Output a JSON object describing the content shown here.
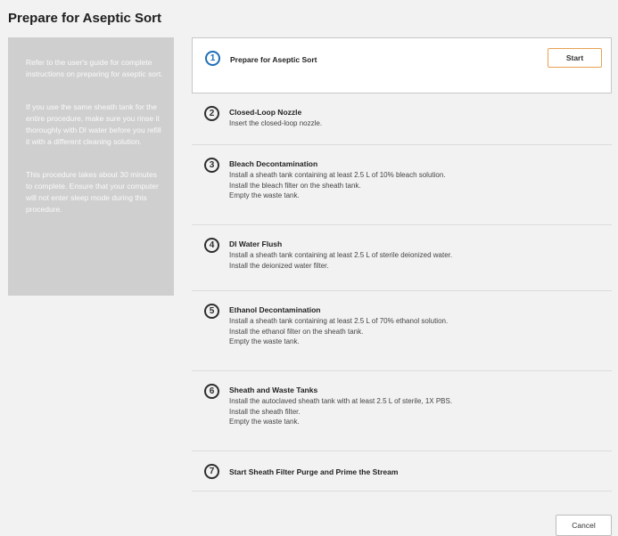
{
  "title": "Prepare for Aseptic Sort",
  "sidebar": {
    "paragraphs": [
      "Refer to the user's guide for complete instructions on preparing for aseptic sort.",
      "If you use the same sheath tank for the entire procedure, make sure you rinse it thoroughly with DI water before you refill it with a different cleaning solution.",
      "This procedure takes about 30 minutes to complete. Ensure that your computer will not enter sleep mode during this procedure."
    ]
  },
  "steps": [
    {
      "number": "1",
      "name": "Prepare for Aseptic Sort",
      "lines": [],
      "button": "Start",
      "active": true
    },
    {
      "number": "2",
      "name": "Closed-Loop Nozzle",
      "lines": [
        "Insert the closed-loop nozzle."
      ]
    },
    {
      "number": "3",
      "name": "Bleach Decontamination",
      "lines": [
        "Install a sheath tank containing at least 2.5 L of 10% bleach solution.",
        "Install the bleach filter on the sheath tank.",
        "Empty the waste tank."
      ]
    },
    {
      "number": "4",
      "name": "DI Water Flush",
      "lines": [
        "Install a sheath tank containing at least 2.5 L of sterile deionized water.",
        "Install the deionized water filter."
      ]
    },
    {
      "number": "5",
      "name": "Ethanol Decontamination",
      "lines": [
        "Install a sheath tank containing at least 2.5 L of 70% ethanol solution.",
        "Install the ethanol filter on the sheath tank.",
        "Empty the waste tank."
      ]
    },
    {
      "number": "6",
      "name": "Sheath and Waste Tanks",
      "lines": [
        "Install the autoclaved sheath tank with at least 2.5 L of sterile, 1X PBS.",
        "Install the sheath filter.",
        "Empty the waste tank."
      ]
    },
    {
      "number": "7",
      "name": "Start Sheath Filter Purge and Prime the Stream",
      "lines": []
    }
  ],
  "footer": {
    "cancel_label": "Cancel"
  },
  "colors": {
    "active_step": "#1e6fb8",
    "start_border": "#e6a252",
    "sidebar_bg": "#cfcfcf"
  }
}
